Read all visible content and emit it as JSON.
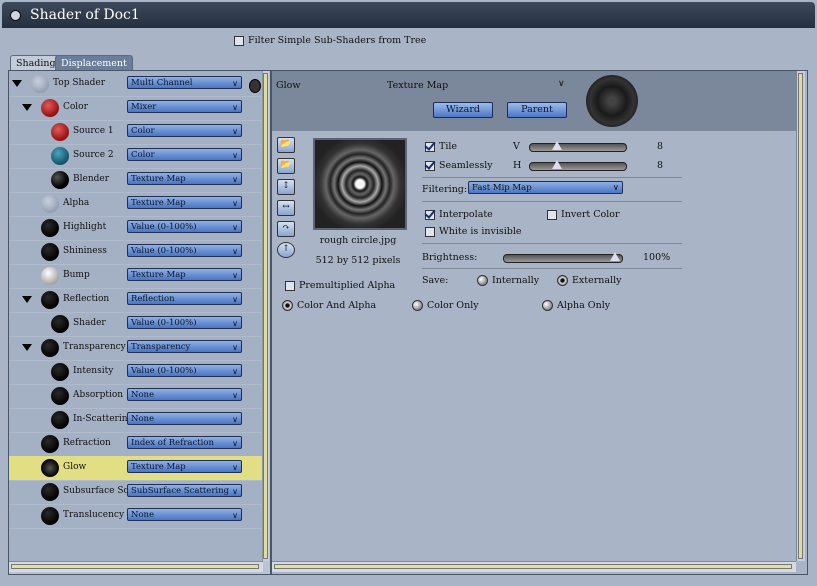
{
  "window": {
    "title": "Shader of Doc1"
  },
  "filter": {
    "label": "Filter Simple Sub-Shaders from Tree",
    "checked": false
  },
  "tabs": [
    {
      "label": "Shading",
      "active": true
    },
    {
      "label": "Displacement",
      "active": false
    }
  ],
  "tree": [
    {
      "label": "Top Shader",
      "value": "Multi Channel",
      "ball": "grey",
      "depth": 0,
      "expanded": true
    },
    {
      "label": "Color",
      "value": "Mixer",
      "ball": "red",
      "depth": 1,
      "expanded": true
    },
    {
      "label": "Source 1",
      "value": "Color",
      "ball": "red",
      "depth": 2
    },
    {
      "label": "Source 2",
      "value": "Color",
      "ball": "teal",
      "depth": 2
    },
    {
      "label": "Blender",
      "value": "Texture Map",
      "ball": "blend",
      "depth": 2
    },
    {
      "label": "Alpha",
      "value": "Texture Map",
      "ball": "grey",
      "depth": 1
    },
    {
      "label": "Highlight",
      "value": "Value (0-100%)",
      "ball": "black",
      "depth": 1
    },
    {
      "label": "Shininess",
      "value": "Value (0-100%)",
      "ball": "black",
      "depth": 1
    },
    {
      "label": "Bump",
      "value": "Texture Map",
      "ball": "white",
      "depth": 1
    },
    {
      "label": "Reflection",
      "value": "Reflection",
      "ball": "black",
      "depth": 1,
      "expanded": true
    },
    {
      "label": "Shader",
      "value": "Value (0-100%)",
      "ball": "black",
      "depth": 2
    },
    {
      "label": "Transparency",
      "value": "Transparency",
      "ball": "black",
      "depth": 1,
      "expanded": true
    },
    {
      "label": "Intensity",
      "value": "Value (0-100%)",
      "ball": "black",
      "depth": 2
    },
    {
      "label": "Absorption",
      "value": "None",
      "ball": "black",
      "depth": 2
    },
    {
      "label": "In-Scattering",
      "value": "None",
      "ball": "black",
      "depth": 2
    },
    {
      "label": "Refraction",
      "value": "Index of Refraction",
      "ball": "black",
      "depth": 1
    },
    {
      "label": "Glow",
      "value": "Texture Map",
      "ball": "glow",
      "depth": 1,
      "selected": true
    },
    {
      "label": "Subsurface Scat",
      "value": "SubSurface Scattering",
      "ball": "black",
      "depth": 1
    },
    {
      "label": "Translucency",
      "value": "None",
      "ball": "black",
      "depth": 1
    }
  ],
  "editor": {
    "channel": "Glow",
    "type": "Texture Map",
    "wizard": "Wizard",
    "parent": "Parent",
    "texture_name": "rough circle.jpg",
    "texture_size": "512 by 512 pixels",
    "premultiplied_alpha": "Premultiplied Alpha",
    "tile": {
      "label": "Tile",
      "checked": true
    },
    "seamlessly": {
      "label": "Seamlessly",
      "checked": true
    },
    "v_label": "V",
    "v_value": "8",
    "h_label": "H",
    "h_value": "8",
    "filtering_label": "Filtering:",
    "filtering_value": "Fast Mip Map",
    "interpolate": {
      "label": "Interpolate",
      "checked": true
    },
    "invert_color": {
      "label": "Invert Color",
      "checked": false
    },
    "white_invisible": {
      "label": "White is invisible",
      "checked": false
    },
    "brightness_label": "Brightness:",
    "brightness_value": "100%",
    "brightness_level": 1.0,
    "save_label": "Save:",
    "save_internally": "Internally",
    "save_externally": "Externally",
    "color_and_alpha": "Color And Alpha",
    "color_only": "Color Only",
    "alpha_only": "Alpha Only"
  }
}
